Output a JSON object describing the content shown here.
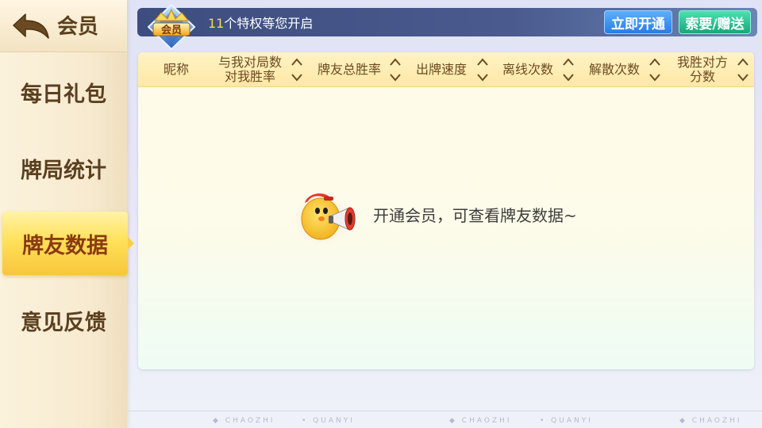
{
  "header": {
    "back_title": "会员"
  },
  "sidebar": {
    "items": [
      {
        "label": "每日礼包"
      },
      {
        "label": "牌局统计"
      },
      {
        "label": "牌友数据",
        "active": true
      },
      {
        "label": "意见反馈"
      }
    ]
  },
  "vip_bar": {
    "badge_label": "会员",
    "count": "11",
    "privilege_text": "个特权等您开启",
    "open_button": "立即开通",
    "gift_button": "索要/赠送"
  },
  "table": {
    "columns": [
      {
        "line1": "昵称",
        "line2": "",
        "sortable": false
      },
      {
        "line1": "与我对局数",
        "line2": "对我胜率",
        "sortable": true
      },
      {
        "line1": "牌友总胜率",
        "line2": "",
        "sortable": true
      },
      {
        "line1": "出牌速度",
        "line2": "",
        "sortable": true
      },
      {
        "line1": "离线次数",
        "line2": "",
        "sortable": true
      },
      {
        "line1": "解散次数",
        "line2": "",
        "sortable": true
      },
      {
        "line1": "我胜对方",
        "line2": "分数",
        "sortable": true
      }
    ],
    "empty_message": "开通会员，可查看牌友数据~"
  },
  "footer": {
    "watermark": [
      "CHAOZHI",
      "QUANYI",
      "CHAOZHI",
      "QUANYI",
      "CHAOZHI"
    ]
  },
  "colors": {
    "accent_gold": "#f8c63a",
    "header_dark": "#3d4d7f",
    "button_blue": "#2a7ae6",
    "button_green": "#17a77a"
  }
}
